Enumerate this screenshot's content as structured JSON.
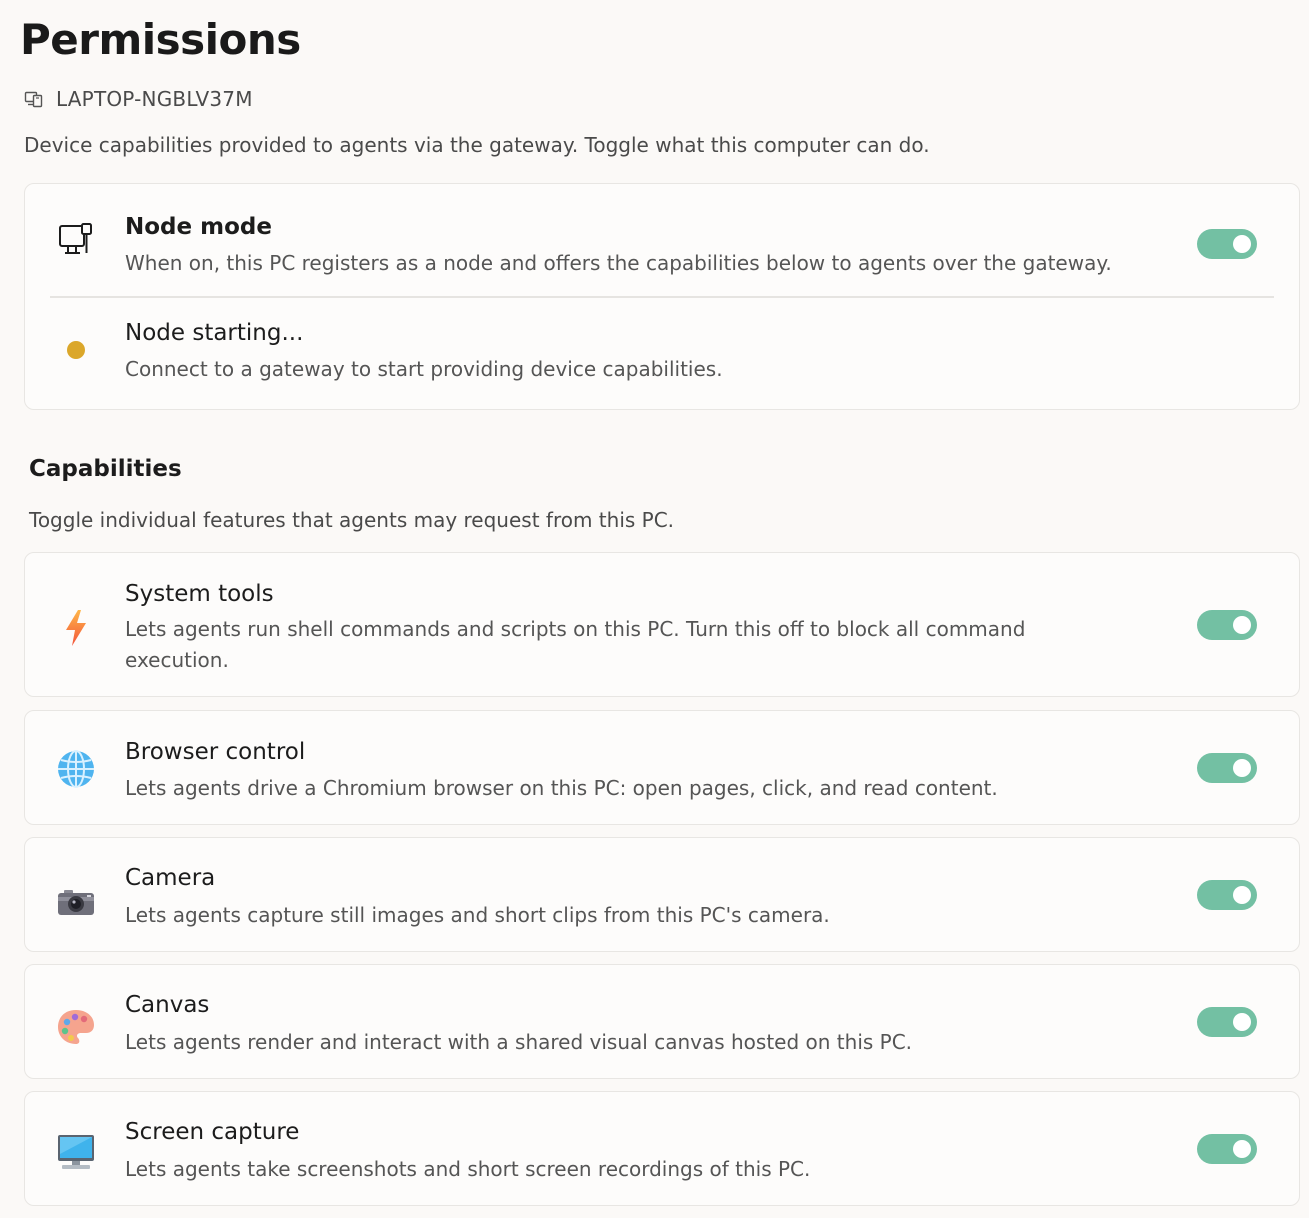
{
  "page": {
    "title": "Permissions",
    "device_name": "LAPTOP-NGBLV37M",
    "device_icon": "devices-icon",
    "description": "Device capabilities provided to agents via the gateway. Toggle what this computer can do."
  },
  "node_card": {
    "node_mode": {
      "title": "Node mode",
      "description": "When on, this PC registers as a node and offers the capabilities below to agents over the gateway.",
      "icon": "pc-node-icon",
      "enabled": true
    },
    "status": {
      "title": "Node starting...",
      "description": "Connect to a gateway to start providing device capabilities.",
      "indicator": "status-dot-icon",
      "indicator_color": "#dba72a"
    }
  },
  "capabilities": {
    "title": "Capabilities",
    "description": "Toggle individual features that agents may request from this PC.",
    "items": [
      {
        "title": "System tools",
        "description": "Lets agents run shell commands and scripts on this PC. Turn this off to block all command execution.",
        "icon": "lightning-icon",
        "enabled": true
      },
      {
        "title": "Browser control",
        "description": "Lets agents drive a Chromium browser on this PC: open pages, click, and read content.",
        "icon": "globe-icon",
        "enabled": true
      },
      {
        "title": "Camera",
        "description": "Lets agents capture still images and short clips from this PC's camera.",
        "icon": "camera-icon",
        "enabled": true
      },
      {
        "title": "Canvas",
        "description": "Lets agents render and interact with a shared visual canvas hosted on this PC.",
        "icon": "palette-icon",
        "enabled": true
      },
      {
        "title": "Screen capture",
        "description": "Lets agents take screenshots and short screen recordings of this PC.",
        "icon": "monitor-icon",
        "enabled": true
      }
    ]
  },
  "colors": {
    "toggle_on": "#73c0a3",
    "background": "#fbf9f7",
    "card": "#fdfcfb"
  }
}
